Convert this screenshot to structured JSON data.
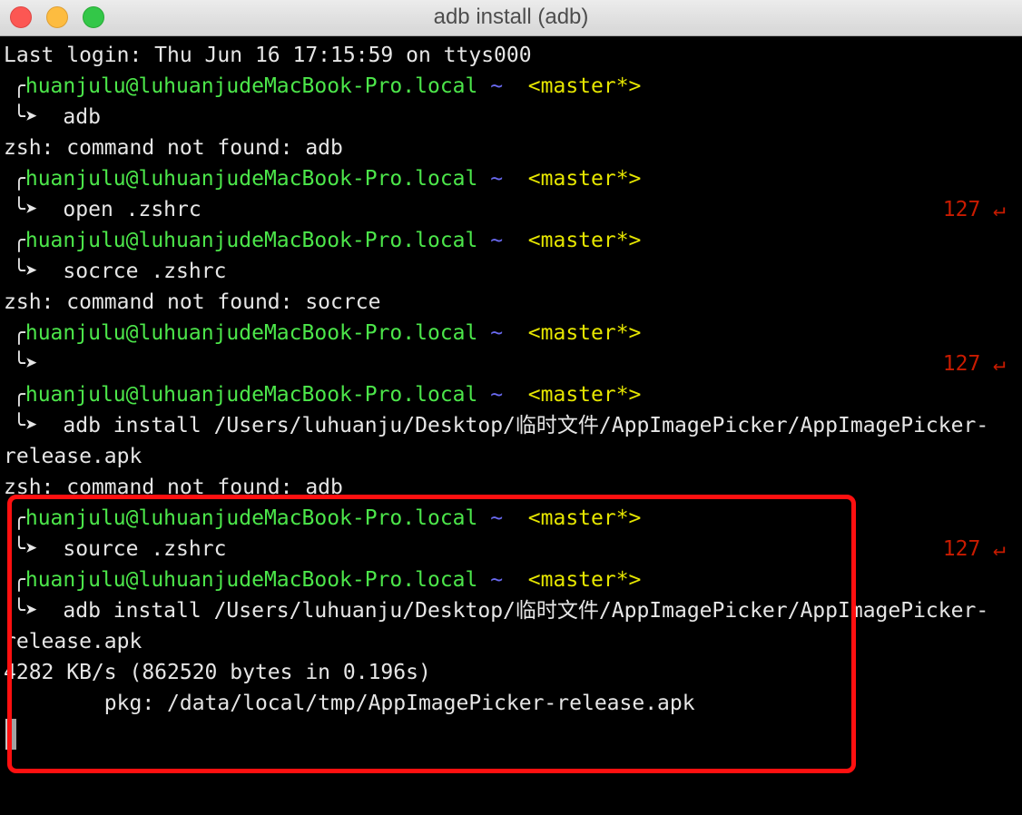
{
  "window": {
    "title": "adb install  (adb)"
  },
  "prompt": {
    "corner": "╭",
    "user_host": "huanjulu@luhuanjudeMacBook-Pro.local",
    "dir": "~",
    "branch": "<master*>",
    "arrow": "╰➤"
  },
  "lines": [
    {
      "kind": "output",
      "text": "Last login: Thu Jun 16 17:15:59 on ttys000"
    },
    {
      "kind": "prompt"
    },
    {
      "kind": "command",
      "text": "adb"
    },
    {
      "kind": "output",
      "text": "zsh: command not found: adb"
    },
    {
      "kind": "prompt"
    },
    {
      "kind": "command",
      "text": "open .zshrc",
      "right": "127 ↵"
    },
    {
      "kind": "prompt"
    },
    {
      "kind": "command",
      "text": "socrce .zshrc"
    },
    {
      "kind": "output",
      "text": "zsh: command not found: socrce"
    },
    {
      "kind": "prompt"
    },
    {
      "kind": "command",
      "text": "",
      "right": "127 ↵"
    },
    {
      "kind": "prompt"
    },
    {
      "kind": "command",
      "text": "adb install /Users/luhuanju/Desktop/临时文件/AppImagePicker/AppImagePicker-"
    },
    {
      "kind": "output",
      "text": "release.apk"
    },
    {
      "kind": "output",
      "text": "zsh: command not found: adb"
    },
    {
      "kind": "prompt"
    },
    {
      "kind": "command",
      "text": "source .zshrc",
      "right": "127 ↵"
    },
    {
      "kind": "prompt"
    },
    {
      "kind": "command",
      "text": "adb install /Users/luhuanju/Desktop/临时文件/AppImagePicker/AppImagePicker-"
    },
    {
      "kind": "output",
      "text": "release.apk"
    },
    {
      "kind": "output",
      "text": "4282 KB/s (862520 bytes in 0.196s)"
    },
    {
      "kind": "output",
      "text": "        pkg: /data/local/tmp/AppImagePicker-release.apk"
    }
  ]
}
